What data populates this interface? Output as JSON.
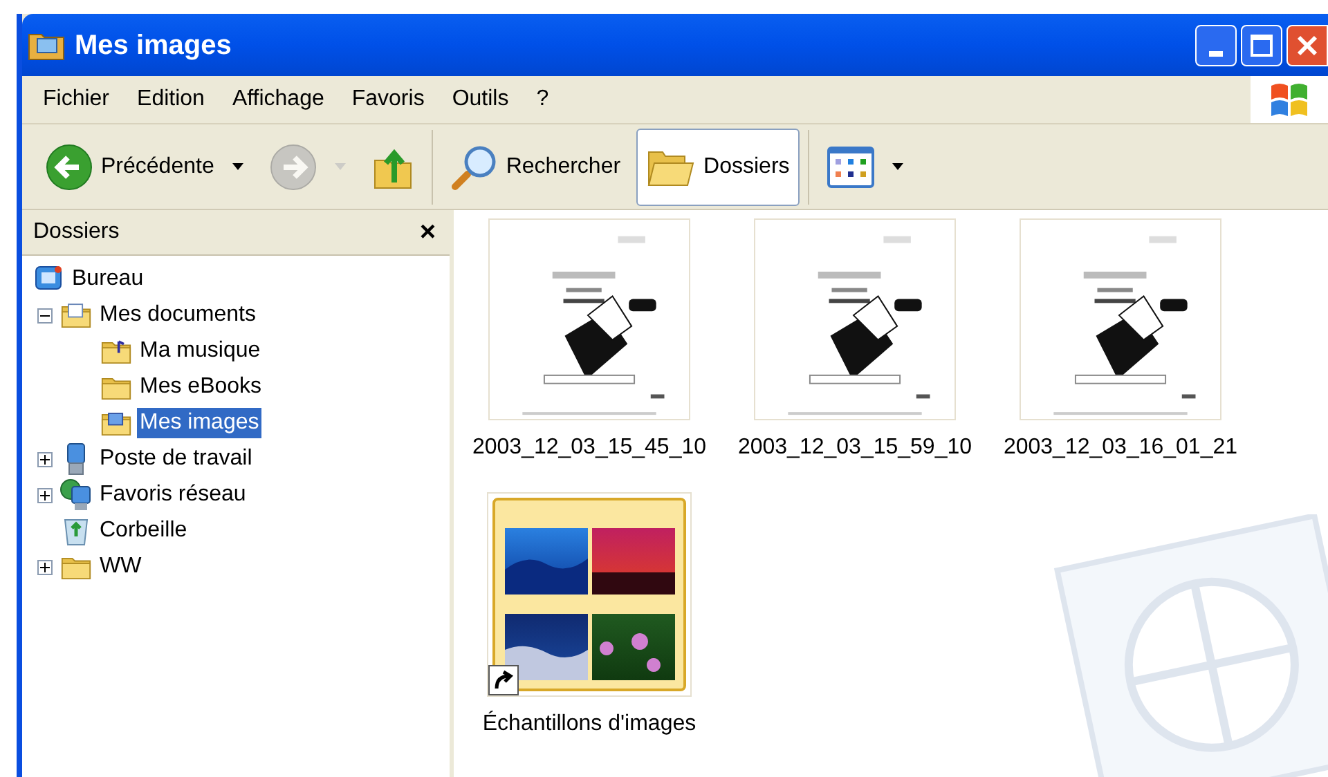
{
  "window": {
    "title": "Mes images"
  },
  "menu": [
    "Fichier",
    "Edition",
    "Affichage",
    "Favoris",
    "Outils",
    "?"
  ],
  "toolbar": [
    {
      "kind": "back",
      "label": "Précédente",
      "disabled": false,
      "selected": false
    },
    {
      "kind": "forward",
      "disabled": true,
      "selected": false
    },
    {
      "kind": "up",
      "disabled": false,
      "selected": false
    },
    {
      "kind": "search",
      "label": "Rechercher",
      "disabled": false,
      "selected": false
    },
    {
      "kind": "folders",
      "label": "Dossiers",
      "disabled": false,
      "selected": true
    },
    {
      "kind": "views",
      "disabled": false,
      "selected": false
    }
  ],
  "sidebar": {
    "title": "Dossiers",
    "close": "×",
    "items": [
      {
        "label": "Bureau",
        "kind": "desktop",
        "selected": false,
        "children": [
          {
            "label": "Mes documents",
            "kind": "documents",
            "selected": false,
            "expanded": true,
            "children": [
              {
                "label": "Ma musique",
                "kind": "music",
                "selected": false
              },
              {
                "label": "Mes eBooks",
                "kind": "folder",
                "selected": false
              },
              {
                "label": "Mes images",
                "kind": "pictures",
                "selected": true
              }
            ]
          },
          {
            "label": "Poste de travail",
            "kind": "computer",
            "selected": false,
            "expanded": false
          },
          {
            "label": "Favoris réseau",
            "kind": "network",
            "selected": false,
            "expanded": false
          },
          {
            "label": "Corbeille",
            "kind": "recycle",
            "selected": false
          },
          {
            "label": "WW",
            "kind": "folder",
            "selected": false,
            "expanded": false
          }
        ]
      }
    ]
  },
  "files": [
    {
      "name": "2003_12_03_15_45_10",
      "kind": "document"
    },
    {
      "name": "2003_12_03_15_59_10",
      "kind": "document"
    },
    {
      "name": "2003_12_03_16_01_21",
      "kind": "document"
    },
    {
      "name": "Échantillons d'images",
      "kind": "folder",
      "shortcut": true
    }
  ]
}
